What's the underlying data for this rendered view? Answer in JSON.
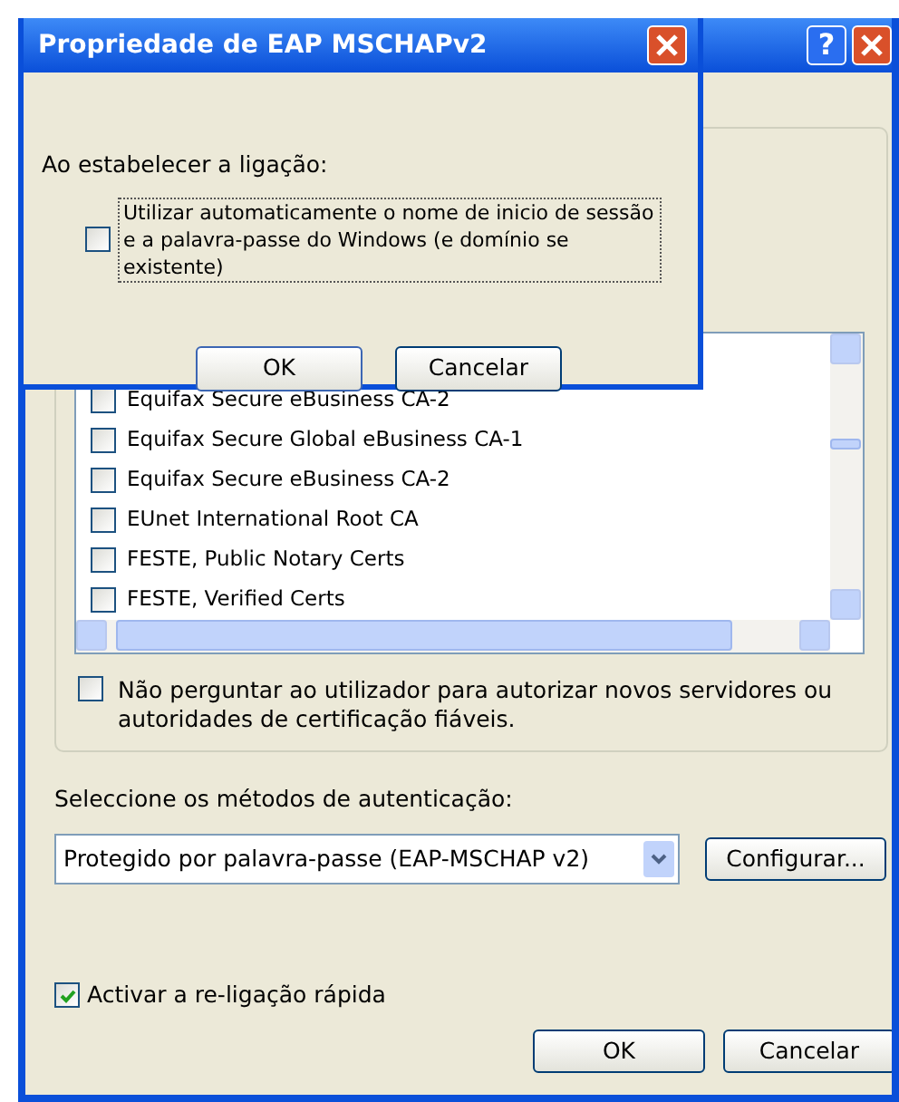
{
  "back_window": {
    "help_button": "?",
    "certificates": [
      {
        "label": "Equifax Secure eBusiness CA-2",
        "checked": false
      },
      {
        "label": "Equifax Secure Global eBusiness CA-1",
        "checked": false
      },
      {
        "label": "Equifax Secure eBusiness CA-2",
        "checked": false
      },
      {
        "label": "EUnet International Root CA",
        "checked": false
      },
      {
        "label": "FESTE, Public Notary Certs",
        "checked": false
      },
      {
        "label": "FESTE, Verified Certs",
        "checked": false
      }
    ],
    "dont_ask": {
      "label": "Não perguntar ao utilizador para autorizar novos servidores ou autoridades de certificação fiáveis.",
      "checked": false
    },
    "method_label": "Seleccione os métodos de autenticação:",
    "method_value": "Protegido por palavra-passe (EAP-MSCHAP v2)",
    "configure_button": "Configurar...",
    "fast_reconnect": {
      "label": "Activar a re-ligação rápida",
      "checked": true
    },
    "buttons": [
      "OK",
      "Cancelar"
    ]
  },
  "dialog": {
    "title": "Propriedade de EAP MSCHAPv2",
    "heading": "Ao estabelecer a ligação:",
    "auto_logon": {
      "label": "Utilizar automaticamente o nome de inicio de sessão e a palavra-passe do Windows (e domínio se existente)",
      "checked": false
    },
    "buttons": [
      "OK",
      "Cancelar"
    ]
  }
}
